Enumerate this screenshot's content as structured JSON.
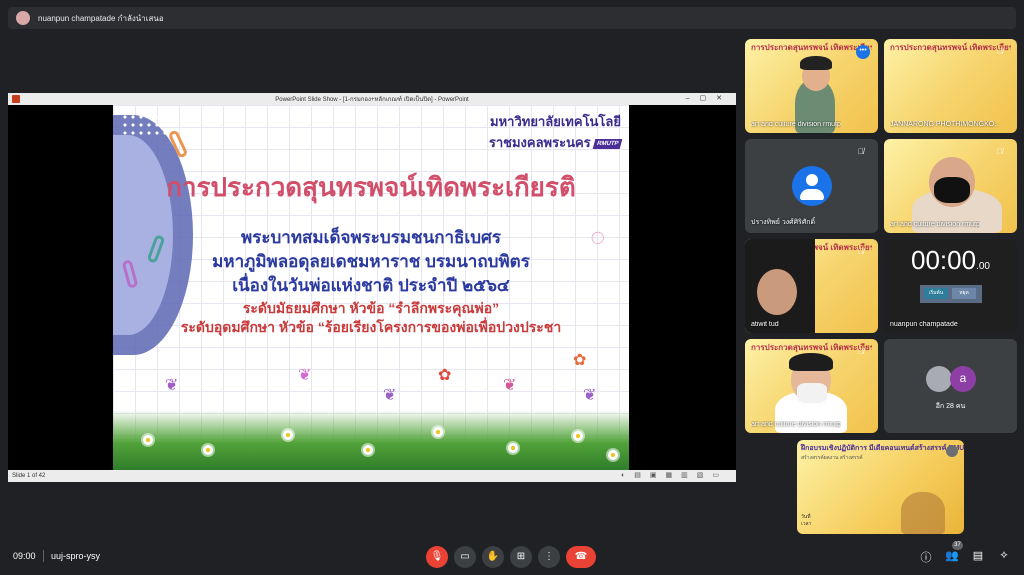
{
  "presenter": {
    "text": "nuanpun champatade กำลังนำเสนอ"
  },
  "ppt": {
    "window_title": "PowerPoint Slide Show - [1-กรมกอง+หลักเกณฑ์ เปิดเป็นปิด] - PowerPoint",
    "status": "Slide 1 of 42"
  },
  "slide": {
    "uni_line1": "มหาวิทยาลัยเทคโนโลยี",
    "uni_line2": "ราชมงคลพระนคร",
    "uni_badge": "RMUTP",
    "title": "การประกวดสุนทรพจน์เทิดพระเกียรติ",
    "sub1": "พระบาทสมเด็จพระบรมชนกาธิเบศร",
    "sub2": "มหาภูมิพลอดุลยเดชมหาราช บรมนาถบพิตร",
    "sub3": "เนื่องในวันพ่อแห่งชาติ ประจำปี ๒๕๖๔",
    "level1": "ระดับมัธยมศึกษา หัวข้อ “รำลึกพระคุณพ่อ”",
    "level2": "ระดับอุดมศึกษา หัวข้อ “ร้อยเรียงโครงการของพ่อเพื่อปวงประชา"
  },
  "participants": [
    {
      "name": "art and culture division rmutp",
      "banner": "การประกวดสุนทรพจน์ เทิดพระเกียรติ"
    },
    {
      "name": "JANNARONG PHOTHIMONGKO...",
      "banner": "การประกวดสุนทรพจน์ เทิดพระเกียรติ"
    },
    {
      "name": "ปรางทิพย์ วงศ์ศิริศักดิ์",
      "banner": ""
    },
    {
      "name": "art and culture division rmutp",
      "banner": ""
    },
    {
      "name": "atiwit tud",
      "banner": "การประกวดสุนทรพจน์ เทิดพระเกียรติ"
    },
    {
      "name": "nuanpun champatade",
      "clock": "00:00",
      "clock_small": ".00",
      "btn_start": "เริ่มต้น",
      "btn_stop": "หยุด"
    },
    {
      "name": "art and culture division rmutp",
      "banner": "การประกวดสุนทรพจน์ เทิดพระเกียรติ"
    },
    {
      "others_letter": "a",
      "others_count": "อีก 28 คน"
    }
  ],
  "self_view": {
    "banner": "ฝึกอบรมเชิงปฏิบัติการ มีเดียคอนเทนต์สร้างสรรค์ RMUTP",
    "sub": "สร้างสรรค์ผลงาน สร้างสรรค์",
    "caption1": "วันที่",
    "caption2": "เวลา"
  },
  "bottom": {
    "time": "09:00",
    "code": "uuj-spro-ysy",
    "people_count": "37"
  },
  "icons": {
    "mic_off": "mic-off-icon",
    "camera": "camera-icon",
    "hand": "raise-hand-icon",
    "present": "present-icon",
    "more": "more-vert-icon",
    "hangup": "hangup-icon",
    "info": "info-icon",
    "people": "people-icon",
    "chat": "chat-icon",
    "activities": "activities-icon"
  },
  "colors": {
    "hangup": "#ea4335",
    "accent": "#1a73e8",
    "slide_title": "#d14f6a",
    "slide_sub": "#2b3a9f"
  }
}
